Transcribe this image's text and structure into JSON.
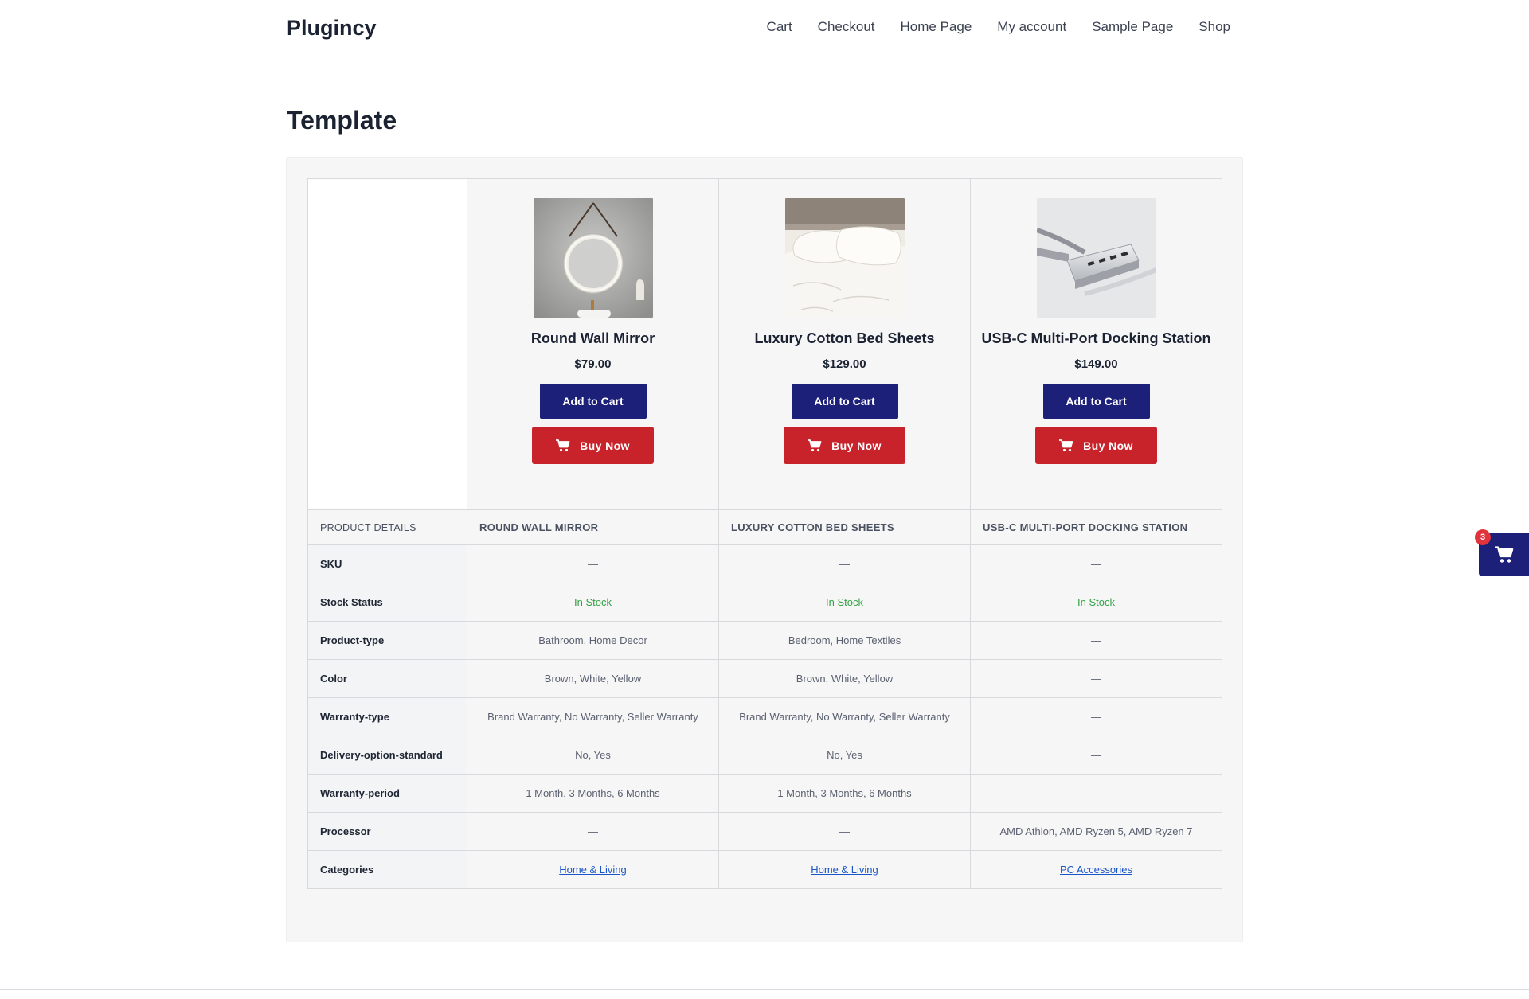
{
  "header": {
    "brand": "Plugincy",
    "nav": [
      "Cart",
      "Checkout",
      "Home Page",
      "My account",
      "Sample Page",
      "Shop"
    ]
  },
  "page_title": "Template",
  "products": [
    {
      "name": "Round Wall Mirror",
      "price": "$79.00",
      "add_to_cart": "Add to Cart",
      "buy_now": "Buy Now",
      "image": "round-wall-mirror-photo"
    },
    {
      "name": "Luxury Cotton Bed Sheets",
      "price": "$129.00",
      "add_to_cart": "Add to Cart",
      "buy_now": "Buy Now",
      "image": "bed-sheets-photo"
    },
    {
      "name": "USB-C Multi-Port Docking Station",
      "price": "$149.00",
      "add_to_cart": "Add to Cart",
      "buy_now": "Buy Now",
      "image": "docking-station-photo"
    }
  ],
  "details": {
    "header_label": "PRODUCT DETAILS",
    "column_headers": [
      "ROUND WALL MIRROR",
      "LUXURY COTTON BED SHEETS",
      "USB-C MULTI-PORT DOCKING STATION"
    ],
    "rows": [
      {
        "label": "SKU",
        "values": [
          "—",
          "—",
          "—"
        ]
      },
      {
        "label": "Stock Status",
        "values": [
          "In Stock",
          "In Stock",
          "In Stock"
        ]
      },
      {
        "label": "Product-type",
        "values": [
          "Bathroom, Home Decor",
          "Bedroom, Home Textiles",
          "—"
        ]
      },
      {
        "label": "Color",
        "values": [
          "Brown, White, Yellow",
          "Brown, White, Yellow",
          "—"
        ]
      },
      {
        "label": "Warranty-type",
        "values": [
          "Brand Warranty, No Warranty, Seller Warranty",
          "Brand Warranty, No Warranty, Seller Warranty",
          "—"
        ]
      },
      {
        "label": "Delivery-option-standard",
        "values": [
          "No, Yes",
          "No, Yes",
          "—"
        ]
      },
      {
        "label": "Warranty-period",
        "values": [
          "1 Month, 3 Months, 6 Months",
          "1 Month, 3 Months, 6 Months",
          "—"
        ]
      },
      {
        "label": "Processor",
        "values": [
          "—",
          "—",
          "AMD Athlon, AMD Ryzen 5, AMD Ryzen 7"
        ]
      },
      {
        "label": "Categories",
        "values": [
          "Home & Living",
          "Home & Living",
          "PC Accessories"
        ]
      }
    ]
  },
  "floating_cart": {
    "count": "3"
  },
  "colors": {
    "add_to_cart": "#1c2079",
    "buy_now": "#c8232a",
    "in_stock": "#34a244",
    "link": "#1a56c7"
  }
}
